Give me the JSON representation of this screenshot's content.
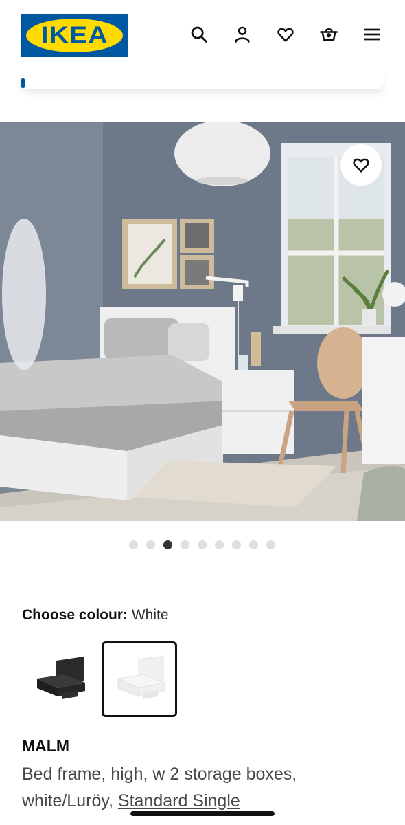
{
  "header": {
    "logo_text": "IKEA",
    "icons": [
      "search-icon",
      "profile-icon",
      "heart-icon",
      "basket-icon",
      "menu-icon"
    ]
  },
  "gallery": {
    "dot_count": 9,
    "active_index": 2
  },
  "colour": {
    "label": "Choose colour:",
    "value": "White",
    "options": [
      "Black-brown",
      "White"
    ],
    "selected_index": 1
  },
  "product": {
    "name": "MALM",
    "description": "Bed frame, high, w 2 storage boxes, white/Luröy,",
    "size_link": "Standard Single"
  },
  "colors": {
    "brand_blue": "#0058a3",
    "brand_yellow": "#ffdb00",
    "wall": "#6e7a88"
  }
}
